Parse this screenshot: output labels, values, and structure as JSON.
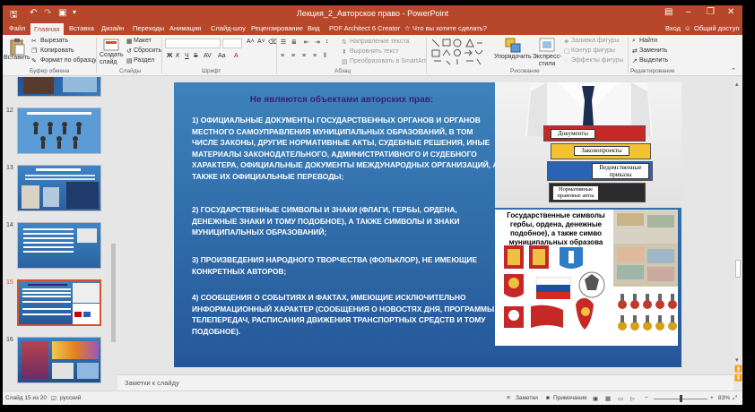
{
  "colors": {
    "accent": "#b7472a",
    "slide_bg": "#2f6aa8",
    "slide_title": "#3a1f79"
  },
  "window": {
    "title": "Лекция_2_Авторское право - PowerPoint"
  },
  "ribbon_tabs": [
    "Файл",
    "Главная",
    "Вставка",
    "Дизайн",
    "Переходы",
    "Анимация",
    "Слайд-шоу",
    "Рецензирование",
    "Вид",
    "PDF Architect 6 Creator"
  ],
  "tell_me": "Что вы хотите сделать?",
  "account": {
    "login": "Вход",
    "share": "Общий доступ"
  },
  "ribbon": {
    "paste": "Вставить",
    "cut": "Вырезать",
    "copy": "Копировать",
    "format_painter": "Формат по образцу",
    "clipboard": "Буфер обмена",
    "new_slide": "Создать слайд",
    "layout": "Макет",
    "reset": "Сбросить",
    "section": "Раздел",
    "slides": "Слайды",
    "font_bold": "Ж",
    "font_italic": "К",
    "font_under": "Ч",
    "font_strike": "S",
    "font": "Шрифт",
    "text_direction": "Направление текста",
    "align_text": "Выровнять текст",
    "smartart": "Преобразовать в SmartArt",
    "paragraph": "Абзац",
    "arrange": "Упорядочить",
    "quick_styles": "Экспресс-стили",
    "shape_fill": "Заливка фигуры",
    "shape_outline": "Контур фигуры",
    "shape_effects": "Эффекты фигуры",
    "drawing": "Рисование",
    "find": "Найти",
    "replace": "Заменить",
    "select": "Выделить",
    "editing": "Редактирование"
  },
  "thumbnails": [
    {
      "num": "12"
    },
    {
      "num": "13"
    },
    {
      "num": "14"
    },
    {
      "num": "15"
    },
    {
      "num": "16"
    }
  ],
  "slide": {
    "title": "Не являются объектами авторских прав:",
    "items": [
      "1) ОФИЦИАЛЬНЫЕ ДОКУМЕНТЫ ГОСУДАРСТВЕННЫХ ОРГАНОВ И ОРГАНОВ МЕСТНОГО САМОУПРАВЛЕНИЯ МУНИЦИПАЛЬНЫХ ОБРАЗОВАНИЙ, В ТОМ ЧИСЛЕ ЗАКОНЫ, ДРУГИЕ НОРМАТИВНЫЕ АКТЫ, СУДЕБНЫЕ РЕШЕНИЯ, ИНЫЕ МАТЕРИАЛЫ ЗАКОНОДАТЕЛЬНОГО, АДМИНИСТРАТИВНОГО И СУДЕБНОГО ХАРАКТЕРА, ОФИЦИАЛЬНЫЕ ДОКУМЕНТЫ МЕЖДУНАРОДНЫХ ОРГАНИЗАЦИЙ, А ТАКЖЕ ИХ ОФИЦИАЛЬНЫЕ ПЕРЕВОДЫ;",
      "2) ГОСУДАРСТВЕННЫЕ СИМВОЛЫ И ЗНАКИ (ФЛАГИ, ГЕРБЫ, ОРДЕНА, ДЕНЕЖНЫЕ ЗНАКИ И ТОМУ ПОДОБНОЕ), А ТАКЖЕ СИМВОЛЫ И ЗНАКИ МУНИЦИПАЛЬНЫХ ОБРАЗОВАНИЙ;",
      "3) ПРОИЗВЕДЕНИЯ НАРОДНОГО ТВОРЧЕСТВА (ФОЛЬКЛОР), НЕ ИМЕЮЩИЕ КОНКРЕТНЫХ АВТОРОВ;",
      "4) СООБЩЕНИЯ О СОБЫТИЯХ И ФАКТАХ, ИМЕЮЩИЕ ИСКЛЮЧИТЕЛЬНО ИНФОРМАЦИОННЫЙ ХАРАКТЕР (СООБЩЕНИЯ О НОВОСТЯХ ДНЯ, ПРОГРАММЫ ТЕЛЕПЕРЕДАЧ, РАСПИСАНИЯ ДВИЖЕНИЯ ТРАНСПОРТНЫХ СРЕДСТВ И ТОМУ ПОДОБНОЕ)."
    ],
    "binder_labels": [
      "Документы",
      "Законопроекты",
      "Ведомственные приказы",
      "Нормативные правовые акты"
    ],
    "symbols_caption_1": "Государственные символы",
    "symbols_caption_2": "гербы, ордена, денежные",
    "symbols_caption_3": "подобное), а также симво",
    "symbols_caption_4": "муниципальных образова"
  },
  "notes_placeholder": "Заметки к слайду",
  "status": {
    "slide_info": "Слайд 15 из 20",
    "language": "русский",
    "notes": "Заметки",
    "comments": "Примечания",
    "zoom": "83%"
  }
}
